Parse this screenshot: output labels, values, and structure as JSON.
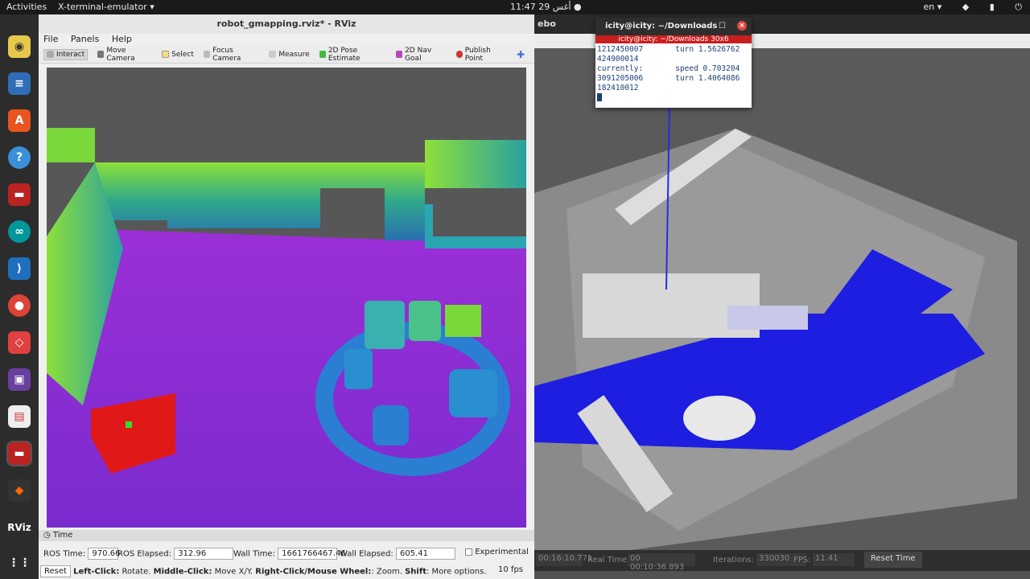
{
  "topbar": {
    "activities": "Activities",
    "app_menu": "X-terminal-emulator ▾",
    "clock": "11:47  أغس 29  ●",
    "lang": "en ▾",
    "tray_icons": [
      "power-icon",
      "wifi-icon",
      "battery-icon",
      "menu-icon"
    ]
  },
  "rviz": {
    "title": "robot_gmapping.rviz* - RViz",
    "menu": [
      "File",
      "Panels",
      "Help"
    ],
    "tools": [
      "Interact",
      "Move Camera",
      "Select",
      "Focus Camera",
      "Measure",
      "2D Pose Estimate",
      "2D Nav Goal",
      "Publish Point"
    ],
    "time_panel": {
      "title": "Time",
      "ros_time_label": "ROS Time:",
      "ros_time": "970.66",
      "ros_elapsed_label": "ROS Elapsed:",
      "ros_elapsed": "312.96",
      "wall_time_label": "Wall Time:",
      "wall_time": "1661766467.46",
      "wall_elapsed_label": "Wall Elapsed:",
      "wall_elapsed": "605.41",
      "experimental": "Experimental",
      "reset": "Reset",
      "hint_lc": "Left-Click:",
      "hint_lc_t": " Rotate. ",
      "hint_mc": "Middle-Click:",
      "hint_mc_t": " Move X/Y. ",
      "hint_rc": "Right-Click/Mouse Wheel:",
      "hint_rc_t": ": Zoom. ",
      "hint_sh": "Shift",
      "hint_sh_t": ": More options.",
      "fps": "10 fps"
    }
  },
  "gazebo": {
    "title": "ebo",
    "sim_time": "00:16:10.771",
    "real_time_label": "Real Time:",
    "real_time": "00 00:10:36.893",
    "iterations_label": "Iterations:",
    "iterations": "330030",
    "fps_label": "FPS:",
    "fps": "11.41",
    "reset_time": "Reset Time"
  },
  "terminal": {
    "title": "icity@icity: ~/Downloads",
    "subtitle": "icity@icity: ~/Downloads 30x6",
    "lines": [
      "1212450007       turn 1.5626762",
      "424900014",
      "currently:       speed 0.703204",
      "3091205006       turn 1.4064086",
      "182410012"
    ]
  }
}
